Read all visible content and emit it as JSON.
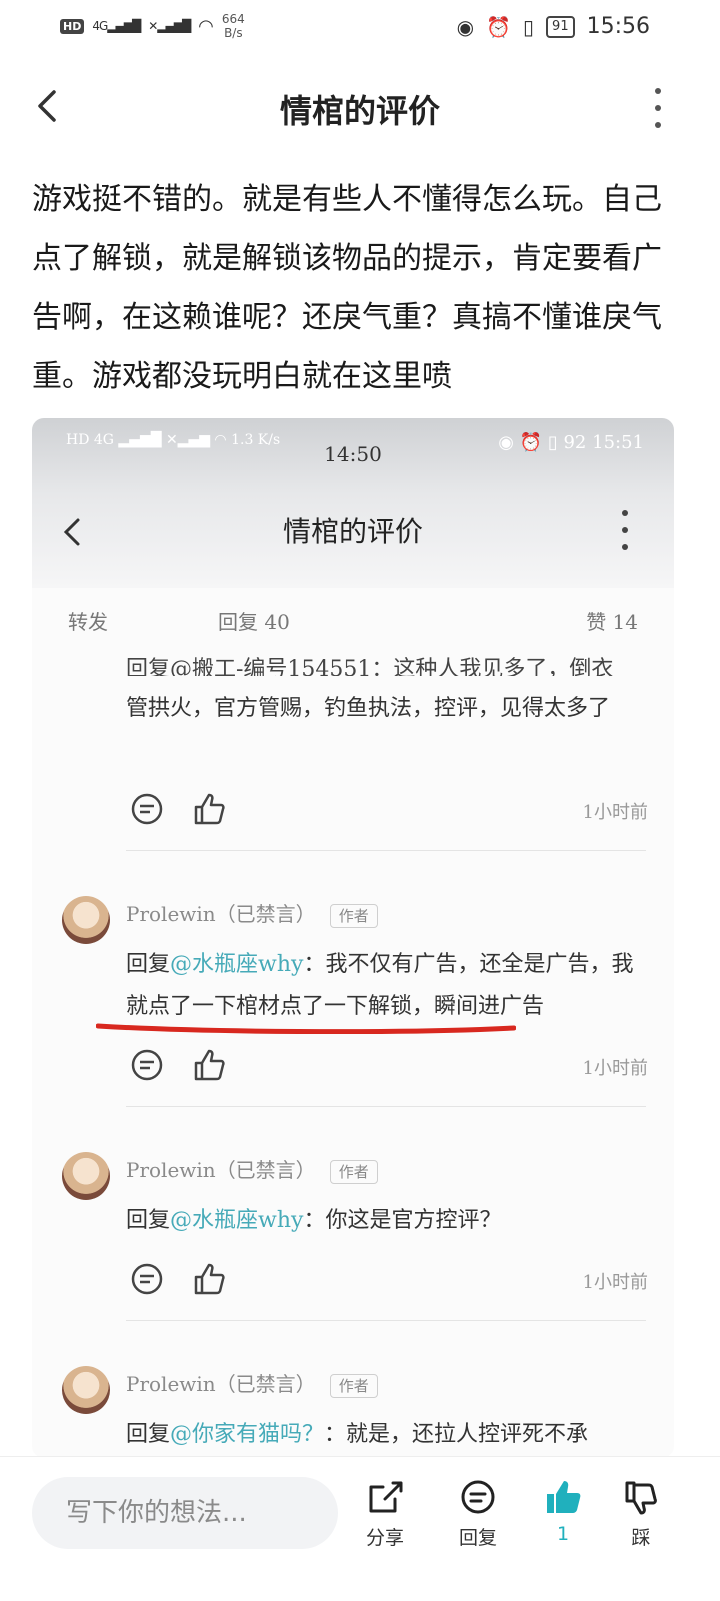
{
  "status_bar": {
    "left_badges": [
      "HD",
      "4G"
    ],
    "net_speed_value": "664",
    "net_speed_unit": "B/s",
    "battery": "91",
    "time": "15:56"
  },
  "header": {
    "title": "情棺的评价"
  },
  "review": {
    "text": "游戏挺不错的。就是有些人不懂得怎么玩。自己点了解锁，就是解锁该物品的提示，肯定要看广告啊，在这赖谁呢？还戾气重？真搞不懂谁戾气重。游戏都没玩明白就在这里喷"
  },
  "screenshot": {
    "status_speed": "1.3\nK/s",
    "status_time": "14:50",
    "status_time_right": "15:51",
    "status_battery": "92",
    "title": "情棺的评价",
    "actions": {
      "forward": "转发",
      "reply": "回复 40",
      "like": "赞 14"
    },
    "top_cut_line": "回复@搬工-编号154551：这种人我见多了，倒衣",
    "comments": [
      {
        "text_prefix": "",
        "mention": "",
        "text": "管拱火，官方管赐，钓鱼执法，控评，见得太多了",
        "time": "1小时前"
      },
      {
        "author": "Prolewin（已禁言）",
        "tag": "作者",
        "text_prefix": "回复",
        "mention": "@水瓶座why",
        "text": "：我不仅有广告，还全是广告，我就点了一下棺材点了一下解锁，瞬间进广告",
        "time": "1小时前"
      },
      {
        "author": "Prolewin（已禁言）",
        "tag": "作者",
        "text_prefix": "回复",
        "mention": "@水瓶座why",
        "text": "：你这是官方控评？",
        "time": "1小时前"
      },
      {
        "author": "Prolewin（已禁言）",
        "tag": "作者",
        "text_prefix": "回复",
        "mention": "@你家有猫吗？",
        "text": "：就是，还拉人控评死不承"
      }
    ]
  },
  "bottom_bar": {
    "input_placeholder": "写下你的想法...",
    "share_label": "分享",
    "reply_label": "回复",
    "like_count": "1",
    "dislike_label": "踩",
    "accent_color": "#20b0bd"
  }
}
